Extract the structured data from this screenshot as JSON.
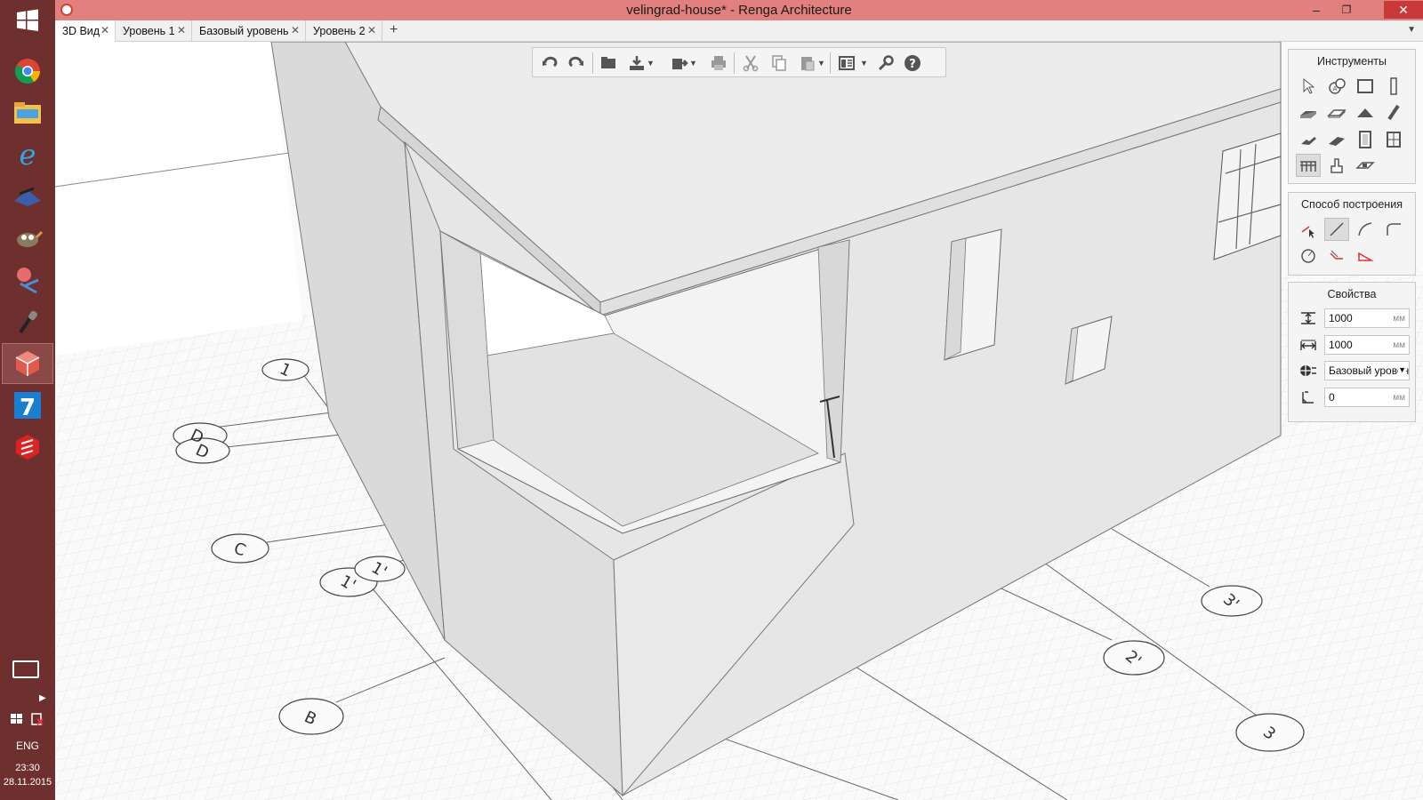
{
  "window": {
    "title": "velingrad-house* - Renga Architecture",
    "controls": {
      "minimize": "–",
      "restore": "❐",
      "close": "✕"
    }
  },
  "tabs": [
    {
      "label": "3D Вид",
      "active": true
    },
    {
      "label": "Уровень 1",
      "active": false
    },
    {
      "label": "Базовый уровень",
      "active": false
    },
    {
      "label": "Уровень 2",
      "active": false
    }
  ],
  "tab_add": "+",
  "tab_menu": "▼",
  "taskbar": {
    "apps": [
      "start-icon",
      "chrome-icon",
      "file-explorer-icon",
      "internet-explorer-icon",
      "app-icon",
      "gimp-icon",
      "snipping-icon",
      "microphone-icon",
      "renga-icon",
      "app7-icon",
      "sketchup-icon"
    ],
    "lang": "ENG",
    "time": "23:30",
    "date": "28.11.2015"
  },
  "panels": {
    "tools_title": "Инструменты",
    "method_title": "Способ построения",
    "props_title": "Свойства"
  },
  "properties": {
    "height": {
      "value": "1000",
      "unit": "мм"
    },
    "width": {
      "value": "1000",
      "unit": "мм"
    },
    "level": {
      "value": "Базовый уровень"
    },
    "offset": {
      "value": "0",
      "unit": "мм"
    }
  },
  "axis_labels": [
    "D",
    "D",
    "C",
    "1'",
    "1'",
    "B",
    "1",
    "3'",
    "2'",
    "3"
  ],
  "colors": {
    "titlebar": "#e27f7f",
    "taskbar": "#6e2f2f",
    "close": "#c83a3a"
  }
}
